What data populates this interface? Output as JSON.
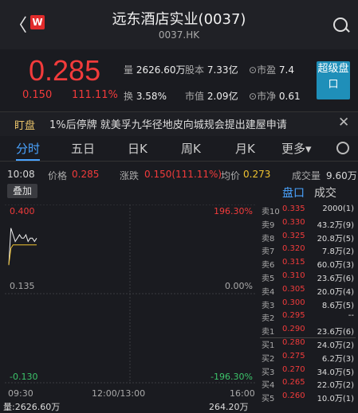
{
  "header": {
    "title": "远东酒店实业(0037)",
    "code": "0037.HK",
    "logo": "W"
  },
  "quote": {
    "price": "0.285",
    "change": "0.150",
    "pct": "111.11%",
    "stats": [
      [
        "量",
        "2626.60万"
      ],
      [
        "股本",
        "7.33亿"
      ],
      [
        "市盈",
        "7.4"
      ],
      [
        "换",
        "3.58%"
      ],
      [
        "市值",
        "2.09亿"
      ],
      [
        "市净",
        "0.61"
      ]
    ],
    "box": "超级盘口"
  },
  "announce": {
    "tag": "盯盘",
    "text": "1%后停牌  就美孚九华径地皮向城规会提出建屋申请"
  },
  "tabs": [
    "分时",
    "五日",
    "日K",
    "周K",
    "月K",
    "更多▾"
  ],
  "info": {
    "time": "10:08",
    "price_label": "价格",
    "price": "0.285",
    "change_label": "涨跌",
    "change": "0.150(111.11%)",
    "avg_label": "均价",
    "avg": "0.273",
    "vol_label": "成交量",
    "vol": "9.60万"
  },
  "diejia": "叠加",
  "chart_axis": {
    "top_left": "0.400",
    "top_right": "196.30%",
    "mid_left": "0.135",
    "mid_right": "0.00%",
    "bot_left": "-0.130",
    "bot_right": "-196.30%",
    "t0": "09:30",
    "t1": "12:00/13:00",
    "t2": "16:00"
  },
  "chart_data": {
    "type": "line",
    "series": [
      {
        "values": [
          0.22,
          0.33,
          0.31,
          0.29,
          0.3,
          0.31,
          0.3,
          0.3,
          0.31,
          0.29,
          0.3,
          0.3,
          0.29,
          0.3
        ]
      },
      {
        "values": [
          0.22,
          0.27,
          0.28,
          0.28,
          0.28,
          0.28,
          0.28,
          0.28,
          0.28,
          0.28,
          0.28,
          0.28,
          0.28,
          0.28
        ]
      }
    ],
    "ylim": [
      -0.13,
      0.4
    ]
  },
  "book": {
    "tabs": [
      "盘口",
      "成交"
    ],
    "asks": [
      [
        "卖10",
        "0.335",
        "2000(1)"
      ],
      [
        "卖9",
        "0.330",
        "43.2万(9)"
      ],
      [
        "卖8",
        "0.325",
        "20.8万(5)"
      ],
      [
        "卖7",
        "0.320",
        "7.8万(2)"
      ],
      [
        "卖6",
        "0.315",
        "60.0万(3)"
      ],
      [
        "卖5",
        "0.310",
        "23.6万(6)"
      ],
      [
        "卖4",
        "0.305",
        "20.0万(4)"
      ],
      [
        "卖3",
        "0.300",
        "8.6万(5)"
      ],
      [
        "卖2",
        "0.295",
        "--"
      ],
      [
        "卖1",
        "0.290",
        "23.6万(6)"
      ]
    ],
    "bids": [
      [
        "买1",
        "0.280",
        "24.0万(2)"
      ],
      [
        "买2",
        "0.275",
        "6.2万(3)"
      ],
      [
        "买3",
        "0.270",
        "34.0万(5)"
      ],
      [
        "买4",
        "0.265",
        "22.0万(2)"
      ],
      [
        "买5",
        "0.260",
        "10.0万(1)"
      ]
    ]
  },
  "bottom": {
    "left": "量:2626.60万",
    "right": "264.20万"
  }
}
